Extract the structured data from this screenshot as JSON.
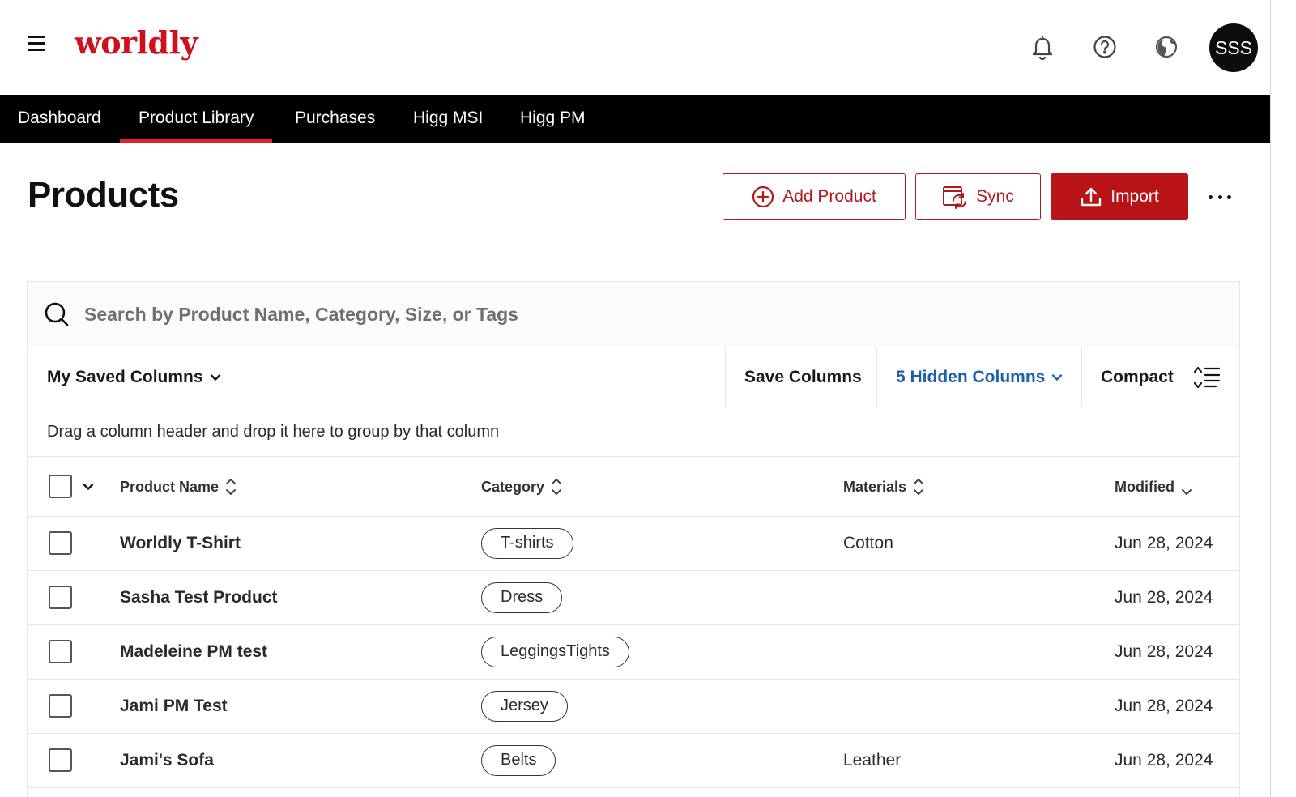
{
  "header": {
    "logo_text": "worldly",
    "avatar_initials": "SSS",
    "icons": [
      "menu-icon",
      "bell-icon",
      "help-icon",
      "globe-icon"
    ]
  },
  "nav": {
    "items": [
      {
        "label": "Dashboard",
        "active": false
      },
      {
        "label": "Product Library",
        "active": true
      },
      {
        "label": "Purchases",
        "active": false
      },
      {
        "label": "Higg MSI",
        "active": false
      },
      {
        "label": "Higg PM",
        "active": false
      }
    ]
  },
  "page": {
    "title": "Products",
    "add_product_label": "Add Product",
    "sync_label": "Sync",
    "import_label": "Import"
  },
  "search": {
    "placeholder": "Search by Product Name, Category, Size, or Tags",
    "value": ""
  },
  "toolbar": {
    "saved_columns_label": "My Saved Columns",
    "save_columns_label": "Save Columns",
    "hidden_columns_label": "5 Hidden Columns",
    "compact_label": "Compact"
  },
  "grouping": {
    "hint": "Drag a column header and drop it here to group by that column"
  },
  "table": {
    "columns": [
      "Product Name",
      "Category",
      "Materials",
      "Modified"
    ],
    "rows": [
      {
        "name": "Worldly T-Shirt",
        "category": "T-shirts",
        "materials": "Cotton",
        "modified": "Jun 28, 2024"
      },
      {
        "name": "Sasha Test Product",
        "category": "Dress",
        "materials": "",
        "modified": "Jun 28, 2024"
      },
      {
        "name": "Madeleine PM test",
        "category": "LeggingsTights",
        "materials": "",
        "modified": "Jun 28, 2024"
      },
      {
        "name": "Jami PM Test",
        "category": "Jersey",
        "materials": "",
        "modified": "Jun 28, 2024"
      },
      {
        "name": "Jami's Sofa",
        "category": "Belts",
        "materials": "Leather",
        "modified": "Jun 28, 2024"
      }
    ]
  },
  "colors": {
    "brand_red": "#d0101b",
    "button_red": "#b81418",
    "nav_bg": "#000000",
    "nav_active_underline": "#e0202a",
    "link_blue": "#1f5fae"
  }
}
